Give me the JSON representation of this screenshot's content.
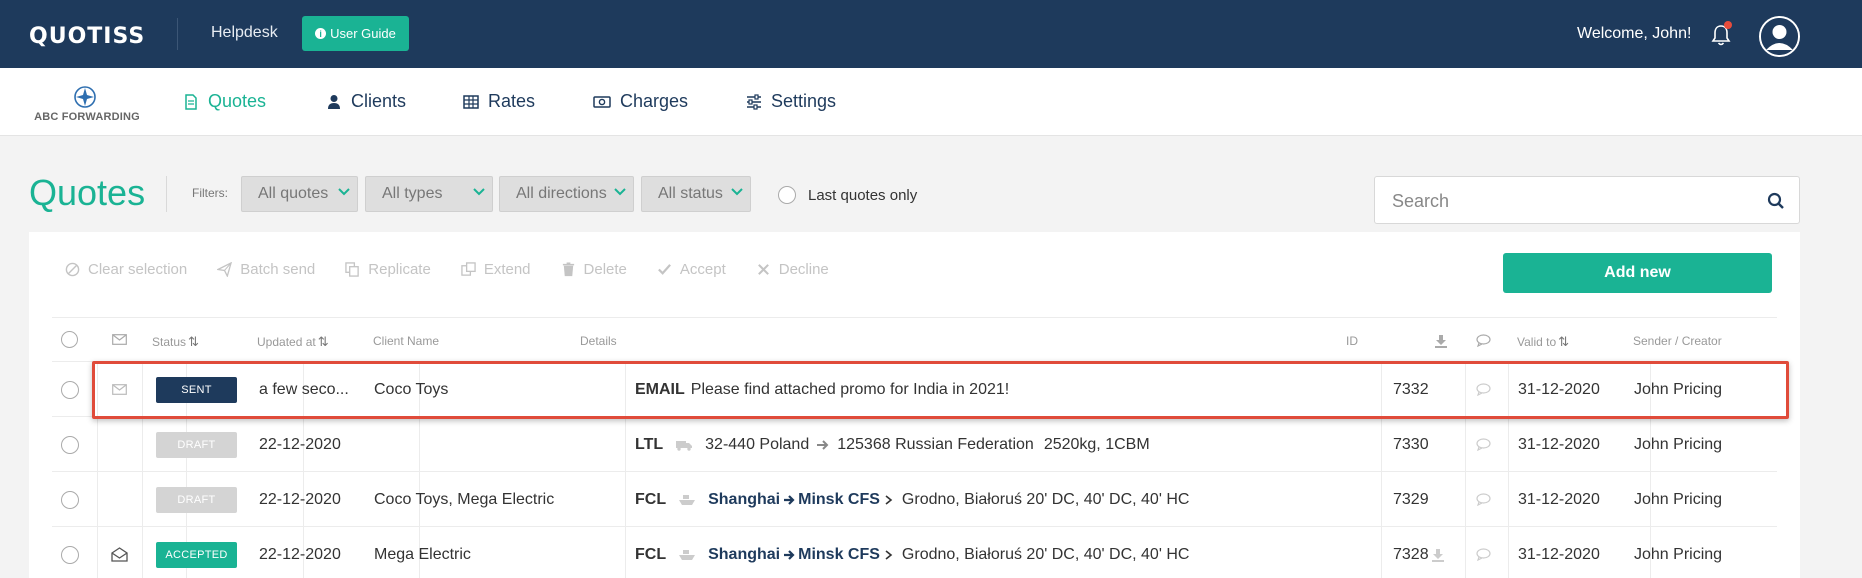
{
  "header": {
    "logo": "QUOTISS",
    "helpdesk": "Helpdesk",
    "user_guide": "User Guide",
    "welcome": "Welcome, John!"
  },
  "nav": {
    "brand": "ABC FORWARDING",
    "items": [
      {
        "label": "Quotes",
        "icon": "document-icon",
        "active": true
      },
      {
        "label": "Clients",
        "icon": "user-icon"
      },
      {
        "label": "Rates",
        "icon": "table-icon"
      },
      {
        "label": "Charges",
        "icon": "money-icon"
      },
      {
        "label": "Settings",
        "icon": "sliders-icon"
      }
    ]
  },
  "page": {
    "title": "Quotes",
    "filters_label": "Filters:",
    "filters": [
      "All quotes",
      "All types",
      "All directions",
      "All status"
    ],
    "last_quotes": "Last quotes only",
    "search_placeholder": "Search",
    "add_new": "Add new"
  },
  "actions": [
    "Clear selection",
    "Batch send",
    "Replicate",
    "Extend",
    "Delete",
    "Accept",
    "Decline"
  ],
  "table": {
    "headers": {
      "status": "Status",
      "updated": "Updated at",
      "client": "Client Name",
      "details": "Details",
      "id": "ID",
      "valid": "Valid to",
      "sender": "Sender / Creator"
    },
    "rows": [
      {
        "status": "SENT",
        "status_type": "sent",
        "mail": "envelope-icon",
        "updated": "a few seco...",
        "client": "Coco Toys",
        "mode": "EMAIL",
        "text": "Please find attached promo for India in 2021!",
        "id": "7332",
        "download": false,
        "valid": "31-12-2020",
        "sender": "John Pricing"
      },
      {
        "status": "DRAFT",
        "status_type": "draft",
        "mail": "",
        "updated": "22-12-2020",
        "client": "",
        "mode": "LTL",
        "from": "32-440 Poland",
        "to": "125368 Russian Federation",
        "extra": "2520kg, 1CBM",
        "id": "7330",
        "download": false,
        "valid": "31-12-2020",
        "sender": "John Pricing"
      },
      {
        "status": "DRAFT",
        "status_type": "draft",
        "mail": "",
        "updated": "22-12-2020",
        "client": "Coco Toys, Mega Electric",
        "mode": "FCL",
        "from": "Shanghai",
        "to": "Minsk CFS",
        "extra": "Grodno, Białoruś 20' DC, 40' DC, 40' HC",
        "id": "7329",
        "download": false,
        "valid": "31-12-2020",
        "sender": "John Pricing"
      },
      {
        "status": "ACCEPTED",
        "status_type": "accepted",
        "mail": "open-envelope-icon",
        "updated": "22-12-2020",
        "client": "Mega Electric",
        "mode": "FCL",
        "from": "Shanghai",
        "to": "Minsk CFS",
        "extra": "Grodno, Białoruś 20' DC, 40' DC, 40' HC",
        "id": "7328",
        "download": true,
        "valid": "31-12-2020",
        "sender": "John Pricing"
      }
    ]
  },
  "colors": {
    "header": "#1e3a5c",
    "accent": "#1ab394",
    "highlight": "#e04b3a"
  }
}
